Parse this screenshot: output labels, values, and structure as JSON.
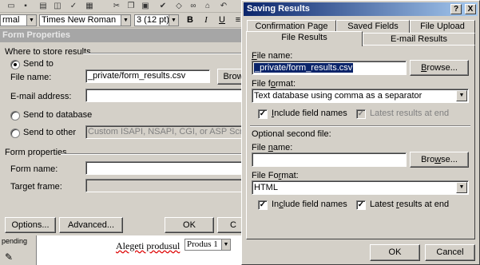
{
  "toolbar": {
    "style_value": "rmal",
    "font_value": "Times New Roman",
    "size_value": "3  (12 pt)",
    "bold": "B",
    "italic": "I",
    "underline": "U"
  },
  "form_properties": {
    "title": "Form Properties",
    "store_group": "Where to store results",
    "send_to": "Send to",
    "file_name_label": "File name:",
    "file_name_value": "_private/form_results.csv",
    "browse_partial": "Brow",
    "email_label": "E-mail address:",
    "email_value": "",
    "send_db": "Send to database",
    "send_other": "Send to other",
    "other_value": "Custom ISAPI, NSAPI, CGI, or ASP Script",
    "form_props_group": "Form properties",
    "form_name_label": "Form name:",
    "form_name_value": "",
    "target_frame_label": "Target frame:",
    "target_frame_value": "",
    "options_button": "Options...",
    "advanced_button": "Advanced...",
    "ok_button": "OK",
    "cancel_button": "C"
  },
  "background_page": {
    "left_text": "pending",
    "prompt_text": "Alegeti produsul",
    "combo_value": "Produs 1"
  },
  "saving_results": {
    "title": "Saving Results",
    "help_icon": "?",
    "close_icon": "X",
    "tabs_back": [
      {
        "label": "Confirmation Page"
      },
      {
        "label": "Saved Fields"
      },
      {
        "label": "File Upload"
      }
    ],
    "tabs_front": [
      {
        "label": "File Results",
        "active": true
      },
      {
        "label": "E-mail Results",
        "active": false
      }
    ],
    "file_name_label": "File name:",
    "file_name_value": "_private/form_results.csv",
    "browse_button": "Browse...",
    "file_format_label": "File format:",
    "file_format_value": "Text database using comma as a separator",
    "include_field_names": "Include field names",
    "include_field_names_checked": true,
    "latest_results": "Latest results at end",
    "latest_results_checked": true,
    "optional_group": "Optional second file:",
    "file_name2_label": "File name:",
    "file_name2_value": "",
    "browse2_button": "Browse...",
    "file_format2_label": "File Format:",
    "file_format2_value": "HTML",
    "include_field_names2": "Include field names",
    "include_field_names2_checked": true,
    "latest_results2": "Latest results at end",
    "latest_results2_checked": true,
    "ok_button": "OK",
    "cancel_button": "Cancel"
  }
}
